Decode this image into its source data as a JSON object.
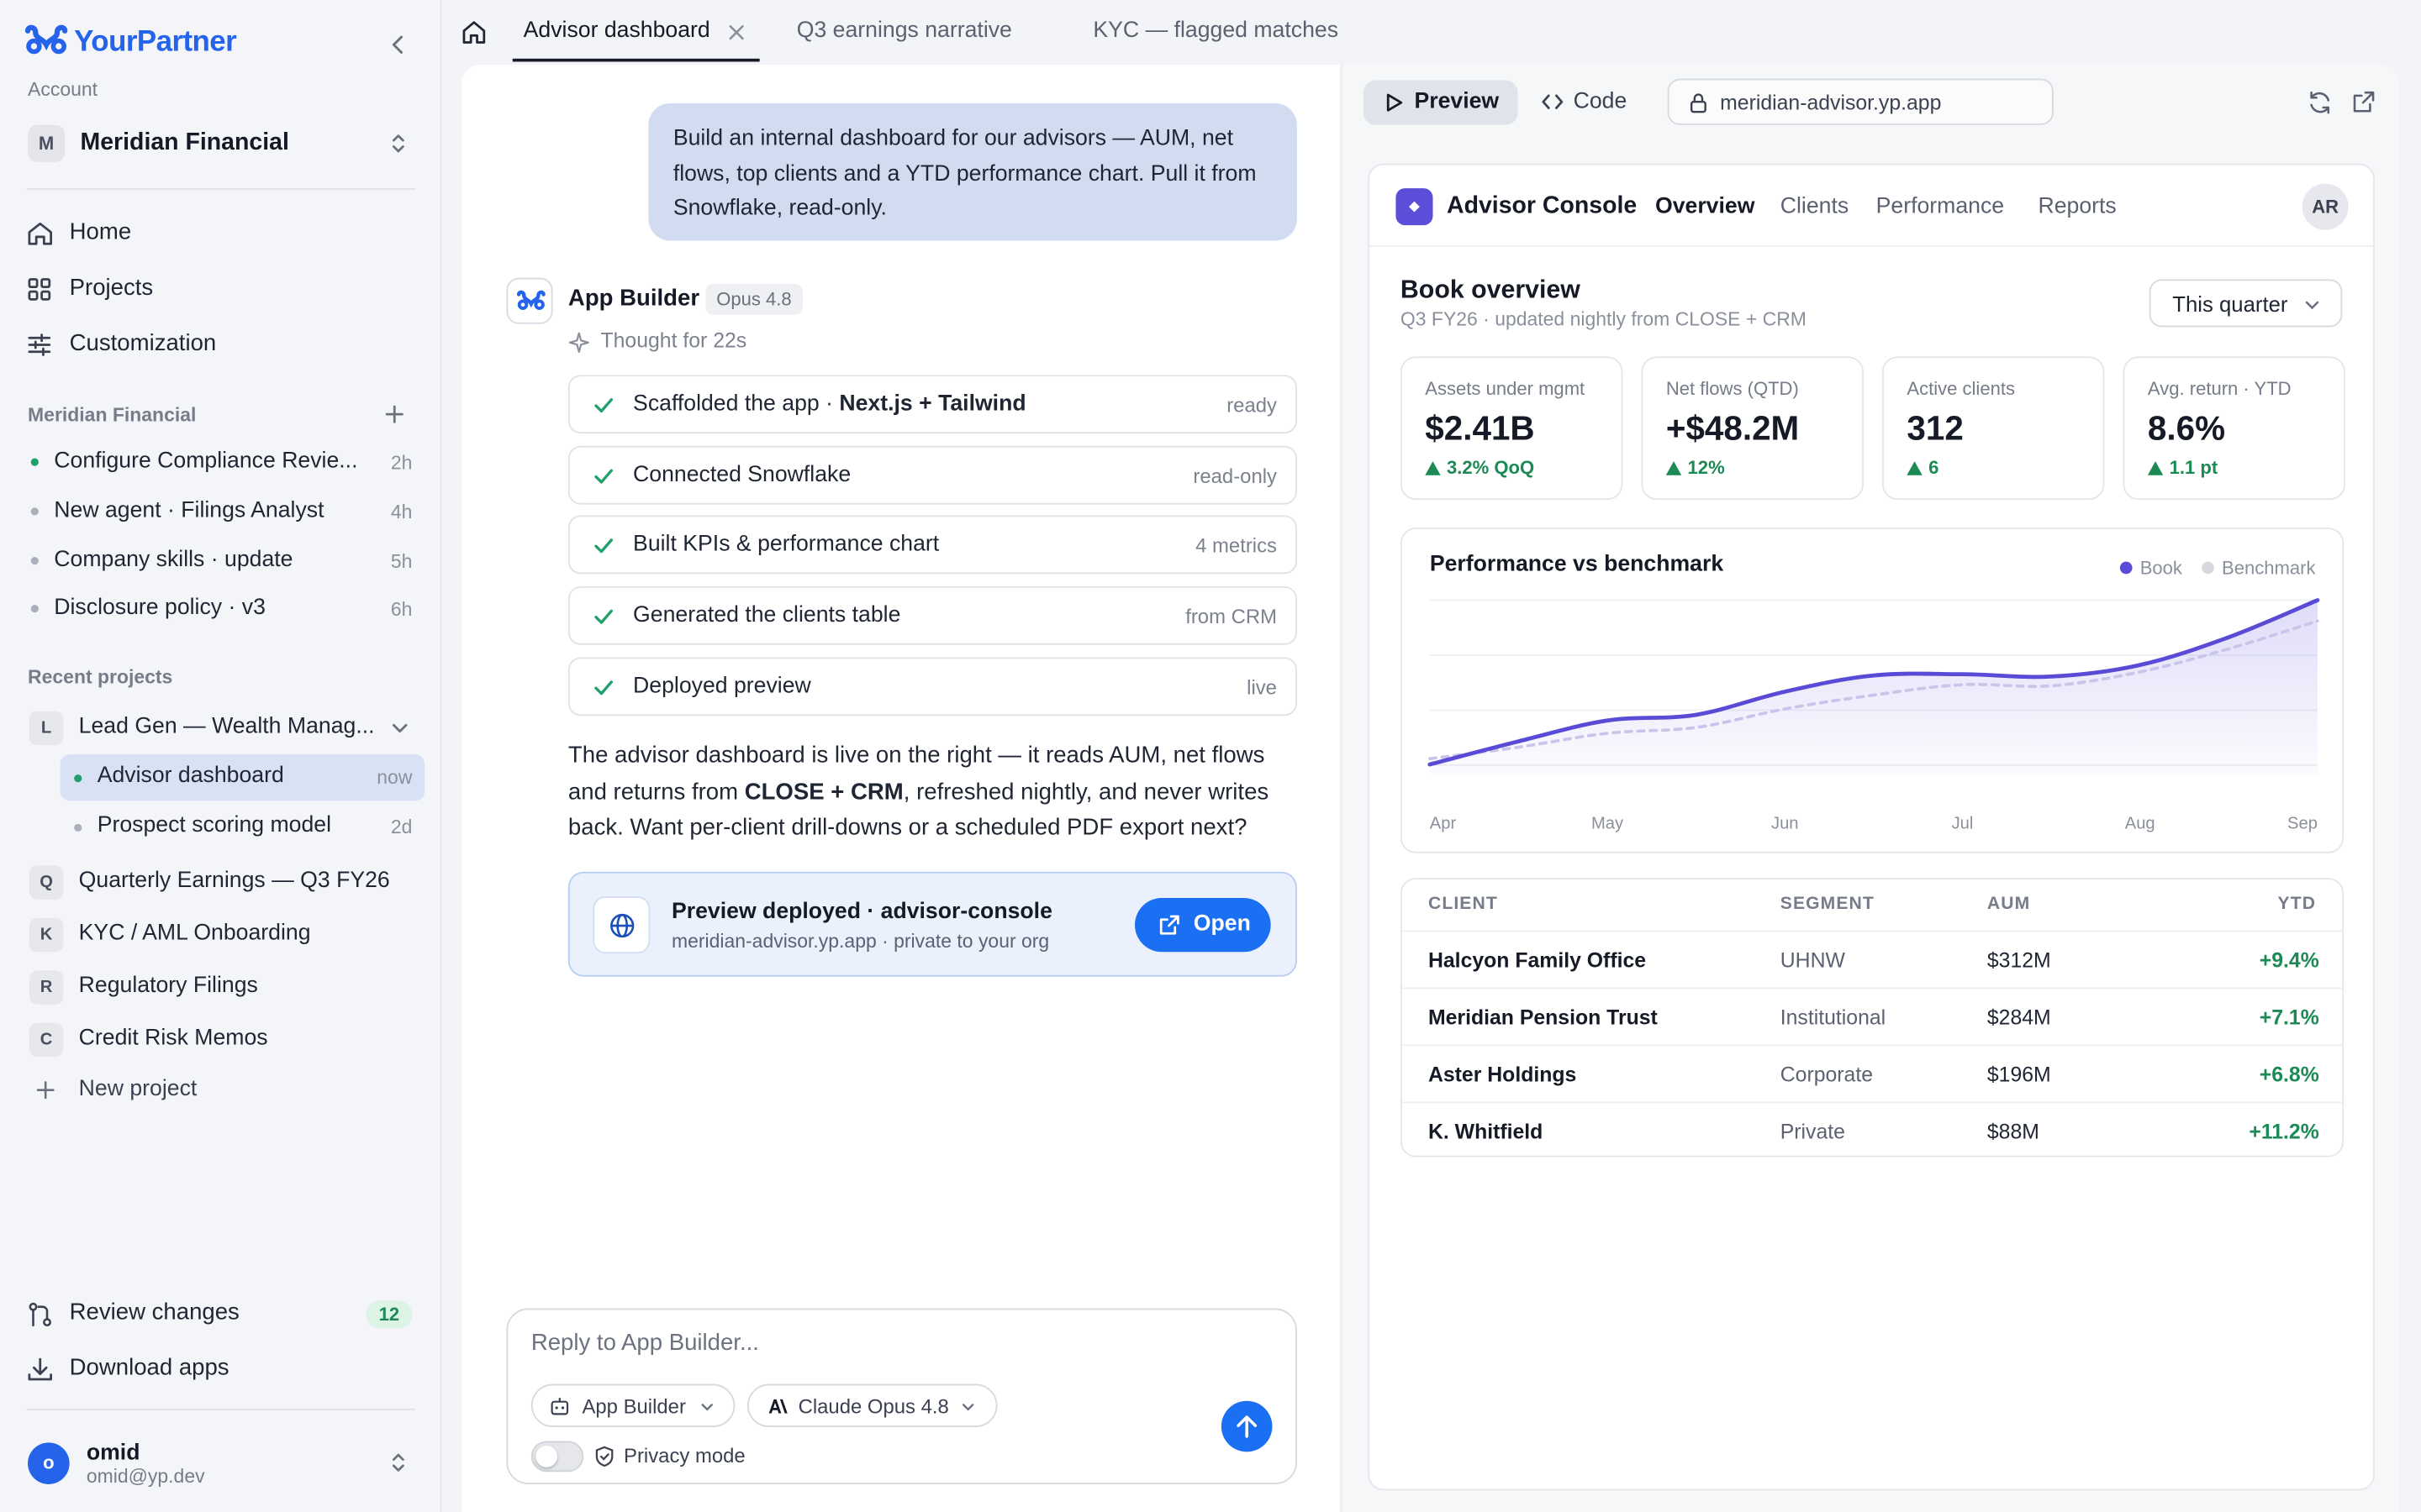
{
  "sidebar": {
    "brand": "YourPartner",
    "account_label": "Account",
    "account_badge": "M",
    "account_name": "Meridian Financial",
    "nav": [
      {
        "label": "Home",
        "icon": "home-icon"
      },
      {
        "label": "Projects",
        "icon": "grid-icon"
      },
      {
        "label": "Customization",
        "icon": "sliders-icon"
      }
    ],
    "section_title": "Meridian Financial",
    "tasks": [
      {
        "label": "Configure Compliance Revie...",
        "time": "2h",
        "status": "active"
      },
      {
        "label": "New agent · Filings Analyst",
        "time": "4h",
        "status": "idle"
      },
      {
        "label": "Company skills · update",
        "time": "5h",
        "status": "idle"
      },
      {
        "label": "Disclosure policy · v3",
        "time": "6h",
        "status": "idle"
      }
    ],
    "recent_title": "Recent projects",
    "projects": [
      {
        "badge": "L",
        "label": "Lead Gen — Wealth Manag..."
      },
      {
        "badge": "Q",
        "label": "Quarterly Earnings — Q3 FY26"
      },
      {
        "badge": "K",
        "label": "KYC / AML Onboarding"
      },
      {
        "badge": "R",
        "label": "Regulatory Filings"
      },
      {
        "badge": "C",
        "label": "Credit Risk Memos"
      }
    ],
    "sub_items": [
      {
        "label": "Advisor dashboard",
        "time": "now",
        "active": true
      },
      {
        "label": "Prospect scoring model",
        "time": "2d",
        "active": false
      }
    ],
    "new_project": "New project",
    "review_changes": "Review changes",
    "review_count": "12",
    "download_apps": "Download apps",
    "user": {
      "initial": "o",
      "name": "omid",
      "email": "omid@yp.dev"
    }
  },
  "tabs": [
    {
      "label": "Advisor dashboard",
      "active": true
    },
    {
      "label": "Q3 earnings narrative",
      "active": false
    },
    {
      "label": "KYC — flagged matches",
      "active": false
    }
  ],
  "chat": {
    "user_message": "Build an internal dashboard for our advisors — AUM, net flows, top clients and a YTD performance chart. Pull it from Snowflake, read-only.",
    "assistant_name": "App Builder",
    "assistant_model": "Opus 4.8",
    "thought": "Thought for 22s",
    "steps": [
      {
        "prefix": "Scaffolded the app · ",
        "bold": "Next.js + Tailwind",
        "tag": "ready"
      },
      {
        "prefix": "Connected Snowflake",
        "bold": "",
        "tag": "read-only"
      },
      {
        "prefix": "Built KPIs & performance chart",
        "bold": "",
        "tag": "4 metrics"
      },
      {
        "prefix": "Generated the clients table",
        "bold": "",
        "tag": "from CRM"
      },
      {
        "prefix": "Deployed preview",
        "bold": "",
        "tag": "live"
      }
    ],
    "reply_part1": "The advisor dashboard is live on the right — it reads AUM, net flows and returns from ",
    "reply_bold": "CLOSE + CRM",
    "reply_part2": ", refreshed nightly, and never writes back. Want per-client drill-downs or a scheduled PDF export next?",
    "deploy_title": "Preview deployed · advisor-console",
    "deploy_sub": "meridian-advisor.yp.app · private to your org",
    "open_label": "Open",
    "composer_placeholder": "Reply to App Builder...",
    "agent_pill": "App Builder",
    "model_pill": "Claude Opus 4.8",
    "privacy_label": "Privacy mode"
  },
  "preview": {
    "preview_label": "Preview",
    "code_label": "Code",
    "url": "meridian-advisor.yp.app"
  },
  "app": {
    "title": "Advisor Console",
    "nav": [
      "Overview",
      "Clients",
      "Performance",
      "Reports"
    ],
    "avatar": "AR",
    "book_title": "Book overview",
    "book_sub": "Q3 FY26 · updated nightly from CLOSE + CRM",
    "period": "This quarter",
    "kpis": [
      {
        "label": "Assets under mgmt",
        "value": "$2.41B",
        "delta": "3.2% QoQ"
      },
      {
        "label": "Net flows (QTD)",
        "value": "+$48.2M",
        "delta": "12%"
      },
      {
        "label": "Active clients",
        "value": "312",
        "delta": "6"
      },
      {
        "label": "Avg. return · YTD",
        "value": "8.6%",
        "delta": "1.1 pt"
      }
    ],
    "table": {
      "headers": [
        "CLIENT",
        "SEGMENT",
        "AUM",
        "YTD"
      ],
      "rows": [
        [
          "Halcyon Family Office",
          "UHNW",
          "$312M",
          "+9.4%"
        ],
        [
          "Meridian Pension Trust",
          "Institutional",
          "$284M",
          "+7.1%"
        ],
        [
          "Aster Holdings",
          "Corporate",
          "$196M",
          "+6.8%"
        ],
        [
          "K. Whitfield",
          "Private",
          "$88M",
          "+11.2%"
        ]
      ]
    }
  },
  "chart_data": {
    "type": "line",
    "title": "Performance vs benchmark",
    "x": [
      "Apr",
      "May",
      "Jun",
      "Jul",
      "Aug",
      "Sep"
    ],
    "x_samples": [
      0,
      0.5,
      1,
      1.5,
      2,
      2.5,
      3,
      3.5,
      4,
      4.5,
      5
    ],
    "series": [
      {
        "name": "Book",
        "color": "#5a4bd6",
        "values": [
          0.1,
          0.3,
          0.48,
          0.53,
          0.73,
          0.87,
          0.88,
          0.86,
          0.96,
          1.2,
          1.52
        ]
      },
      {
        "name": "Benchmark",
        "color": "#c9c4ea",
        "values": [
          0.15,
          0.25,
          0.37,
          0.42,
          0.58,
          0.7,
          0.79,
          0.78,
          0.9,
          1.1,
          1.34
        ]
      }
    ],
    "ylim": [
      0,
      1.6
    ],
    "legend": "top-right",
    "grid": true,
    "area_fill": "Book"
  },
  "colors": {
    "brand": "#2563eb",
    "accent": "#1a6ff2",
    "positive": "#1b8a55",
    "chart_book": "#5a4bd6"
  }
}
